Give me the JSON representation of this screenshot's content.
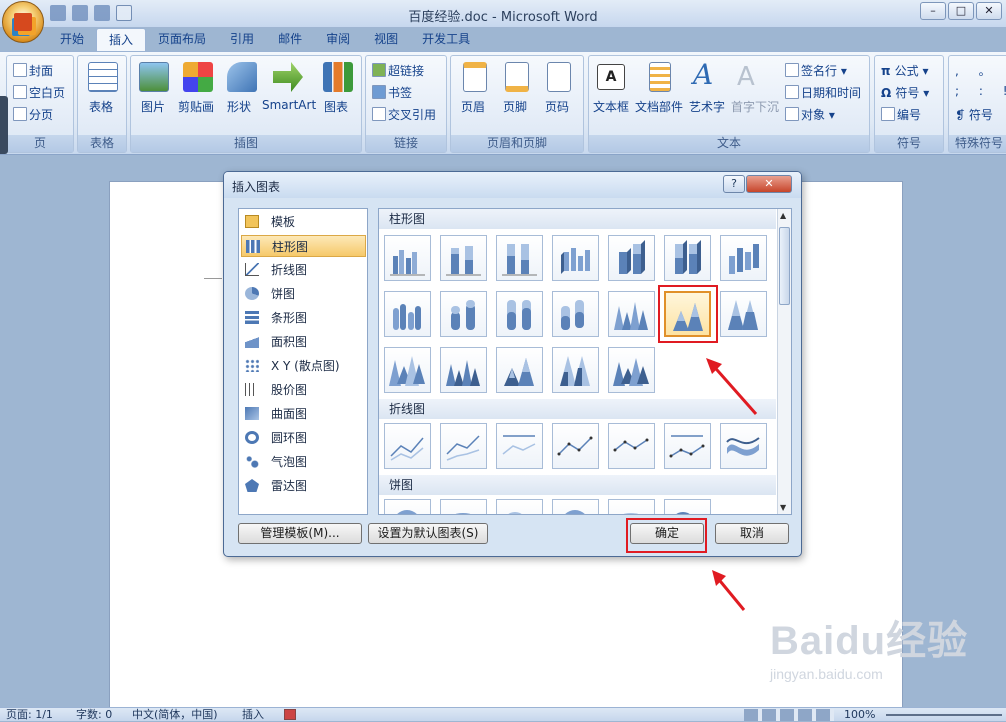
{
  "window": {
    "title": "百度经验.doc - Microsoft Word",
    "controls": [
      "–",
      "□",
      "✕"
    ]
  },
  "ribbon_tabs": [
    "开始",
    "插入",
    "页面布局",
    "引用",
    "邮件",
    "审阅",
    "视图",
    "开发工具"
  ],
  "active_tab": "插入",
  "ribbon": {
    "page_group": {
      "label": "页",
      "items": [
        "封面",
        "空白页",
        "分页"
      ]
    },
    "table_group": {
      "label": "表格",
      "button": "表格"
    },
    "illustrations_group": {
      "label": "插图",
      "buttons": [
        "图片",
        "剪贴画",
        "形状",
        "SmartArt",
        "图表"
      ]
    },
    "links_group": {
      "label": "链接",
      "items": [
        "超链接",
        "书签",
        "交叉引用"
      ]
    },
    "header_footer_group": {
      "label": "页眉和页脚",
      "buttons": [
        "页眉",
        "页脚",
        "页码"
      ]
    },
    "text_group": {
      "label": "文本",
      "buttons": [
        "文本框",
        "文档部件",
        "艺术字",
        "首字下沉"
      ],
      "items": [
        "签名行",
        "日期和时间",
        "对象"
      ]
    },
    "symbols_group": {
      "label": "符号",
      "items": [
        "公式",
        "符号",
        "编号"
      ]
    },
    "special_group": {
      "label": "特殊符号",
      "items": [
        "符号"
      ]
    }
  },
  "dialog": {
    "title": "插入图表",
    "help": "?",
    "close": "✕",
    "categories": [
      "模板",
      "柱形图",
      "折线图",
      "饼图",
      "条形图",
      "面积图",
      "X Y (散点图)",
      "股价图",
      "曲面图",
      "圆环图",
      "气泡图",
      "雷达图"
    ],
    "selected_category": "柱形图",
    "sections": [
      "柱形图",
      "折线图",
      "饼图"
    ],
    "manage_templates": "管理模板(M)...",
    "set_default": "设置为默认图表(S)",
    "ok": "确定",
    "cancel": "取消"
  },
  "statusbar": {
    "page": "页面: 1/1",
    "words": "字数: 0",
    "language": "中文(简体，中国)",
    "mode": "插入",
    "zoom": "100%"
  },
  "watermark": {
    "brand": "Bai",
    "brand2": "du",
    "cn": "经验",
    "url": "jingyan.baidu.com"
  },
  "colors": {
    "accent_red": "#e01b22",
    "selection": "#f6c96a",
    "ribbon": "#dfe9f5"
  }
}
